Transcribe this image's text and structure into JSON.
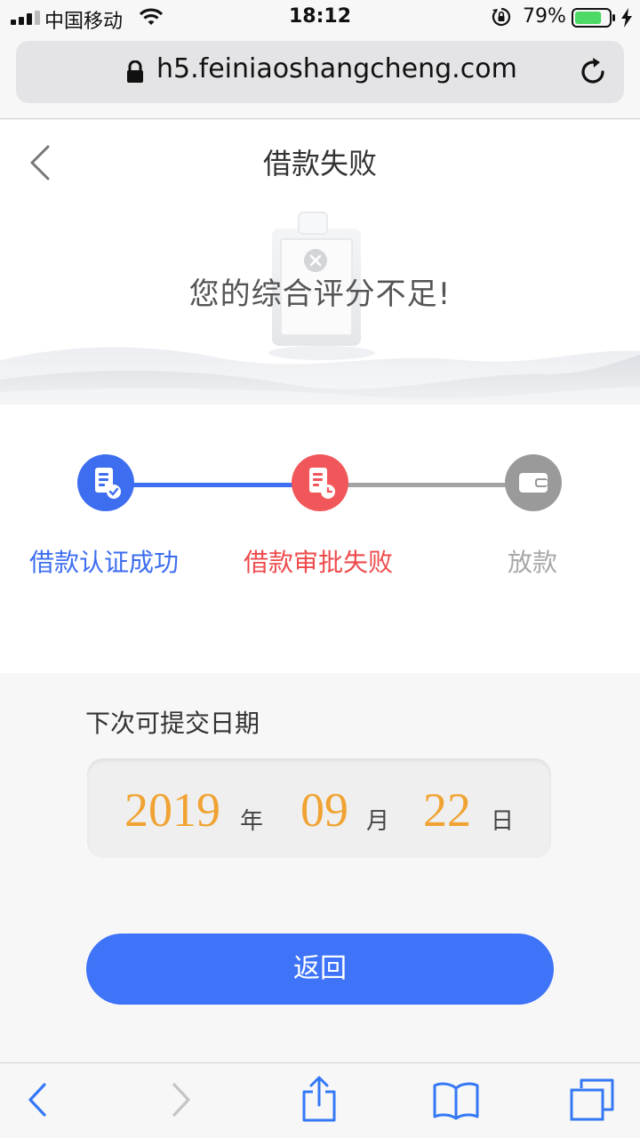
{
  "status_bar": {
    "carrier": "中国移动",
    "time": "18:12",
    "battery_percent": "79%",
    "battery_level": 0.79,
    "icons": [
      "signal-icon",
      "wifi-icon",
      "orientation-lock-icon",
      "battery-icon",
      "charging-icon"
    ]
  },
  "browser": {
    "url": "h5.feiniaoshangcheng.com",
    "icons": [
      "lock-icon",
      "reload-icon"
    ]
  },
  "page": {
    "title": "借款失败",
    "error_message": "您的综合评分不足!"
  },
  "steps": [
    {
      "label": "借款认证成功",
      "state": "complete",
      "color": "#3d6ef0"
    },
    {
      "label": "借款审批失败",
      "state": "failed",
      "color": "#ee4a4c"
    },
    {
      "label": "放款",
      "state": "pending",
      "color": "#a8a8a8"
    }
  ],
  "next_date": {
    "label": "下次可提交日期",
    "year": "2019",
    "year_unit": "年",
    "month": "09",
    "month_unit": "月",
    "day": "22",
    "day_unit": "日"
  },
  "actions": {
    "return_label": "返回"
  },
  "colors": {
    "accent": "#3f74f8",
    "error": "#ee4a4c",
    "date_highlight": "#f0a332"
  },
  "toolbar": {
    "icons": [
      "back-icon",
      "forward-icon",
      "share-icon",
      "bookmarks-icon",
      "tabs-icon"
    ]
  }
}
